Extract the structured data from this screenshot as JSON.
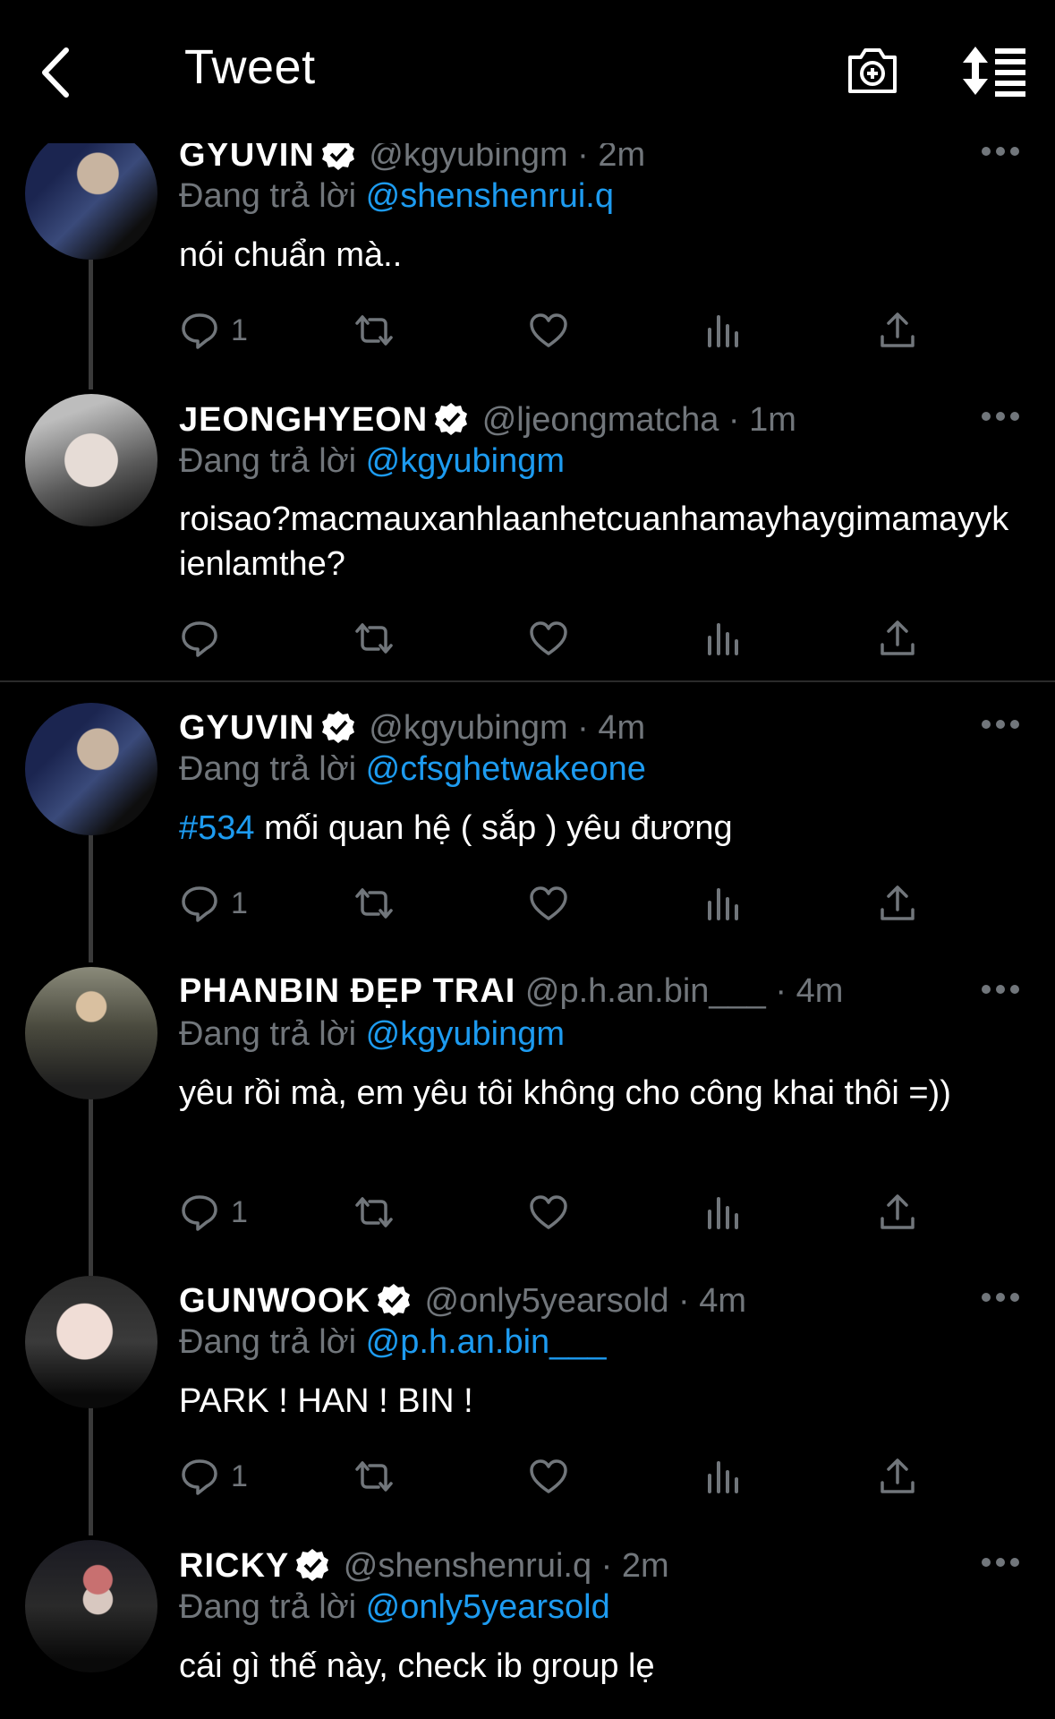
{
  "header": {
    "title": "Tweet"
  },
  "tweets": [
    {
      "name": "GYUVIN",
      "handle": "@kgyubingm",
      "time": "2m",
      "reply_prefix": "Đang trả lời ",
      "reply_to": "@shenshenrui.q",
      "text": "nói chuẩn mà..",
      "replies": "1",
      "avatar_colors": [
        "#2a3a5a",
        "#b8a89a"
      ]
    },
    {
      "name": "JEONGHYEON",
      "handle": "@ljeongmatcha",
      "time": "1m",
      "reply_prefix": "Đang trả lời ",
      "reply_to": "@kgyubingm",
      "text": "roisao?macmauxanhlaanhetcuanhamayhaygimamayykienlamthe?",
      "replies": "",
      "avatar_colors": [
        "#d9d9d9",
        "#555"
      ]
    },
    {
      "name": "GYUVIN",
      "handle": "@kgyubingm",
      "time": "4m",
      "reply_prefix": "Đang trả lời ",
      "reply_to": "@cfsghetwakeone",
      "hashtag": "#534",
      "text": " mối quan hệ ( sắp ) yêu đương",
      "replies": "1",
      "avatar_colors": [
        "#2a3a5a",
        "#b8a89a"
      ]
    },
    {
      "name": "PHANBIN ĐẸP TRAI",
      "handle": "@p.h.an.bin___",
      "time": "4m",
      "reply_prefix": "Đang trả lời ",
      "reply_to": "@kgyubingm",
      "text": "yêu rồi mà, em yêu tôi không cho công khai thôi =))",
      "replies": "1",
      "avatar_colors": [
        "#5a5a4a",
        "#2e2e2e"
      ]
    },
    {
      "name": "GUNWOOK",
      "handle": "@only5yearsold",
      "time": "4m",
      "reply_prefix": "Đang trả lời ",
      "reply_to": "@p.h.an.bin___",
      "text": "PARK ! HAN ! BIN !",
      "replies": "1",
      "avatar_colors": [
        "#e0c8c0",
        "#111"
      ]
    },
    {
      "name": "RICKY",
      "handle": "@shenshenrui.q",
      "time": "2m",
      "reply_prefix": "Đang trả lời ",
      "reply_to": "@only5yearsold",
      "text": "cái gì thế này, check ib group lẹ",
      "replies": "",
      "avatar_colors": [
        "#1a1a1a",
        "#c87070"
      ]
    }
  ],
  "colors": {
    "background": "#000000",
    "link": "#1d9bf0",
    "muted": "#71767b",
    "verified": "#ffffff"
  }
}
